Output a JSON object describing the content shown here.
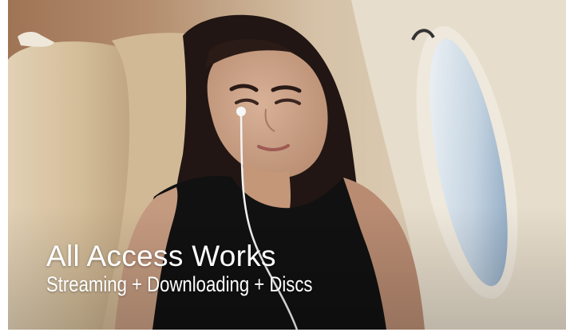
{
  "banner": {
    "title": "All Access Works",
    "subtitle": "Streaming + Downloading + Discs"
  },
  "colors": {
    "seat_leather": "#d9c7a8",
    "cabin_wall": "#d4c2a8",
    "window_sky": "#9fb5c8",
    "hair": "#211613",
    "top": "#111111",
    "skin": "#c99f83",
    "caption_text": "#ffffff"
  },
  "photo": {
    "subject": "woman-wearing-earphones-looking-out-airplane-window",
    "scene": "private-jet-cabin"
  }
}
